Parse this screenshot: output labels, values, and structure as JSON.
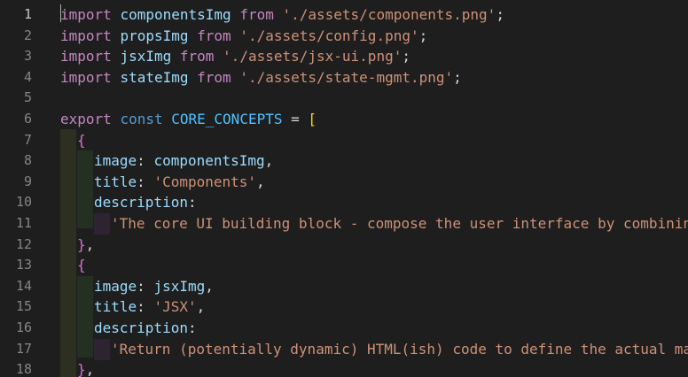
{
  "editor": {
    "line_numbers": [
      "1",
      "2",
      "3",
      "4",
      "5",
      "6",
      "7",
      "8",
      "9",
      "10",
      "11",
      "12",
      "13",
      "14",
      "15",
      "16",
      "17",
      "18"
    ],
    "active_line": "1"
  },
  "code": {
    "l1": {
      "kw": "import",
      "var": "componentsImg",
      "from": "from",
      "str": "'./assets/components.png'",
      "end": ";"
    },
    "l2": {
      "kw": "import",
      "var": "propsImg",
      "from": "from",
      "str": "'./assets/config.png'",
      "end": ";"
    },
    "l3": {
      "kw": "import",
      "var": "jsxImg",
      "from": "from",
      "str": "'./assets/jsx-ui.png'",
      "end": ";"
    },
    "l4": {
      "kw": "import",
      "var": "stateImg",
      "from": "from",
      "str": "'./assets/state-mgmt.png'",
      "end": ";"
    },
    "l6": {
      "export": "export",
      "const": "const",
      "name": "CORE_CONCEPTS",
      "eq": " = ",
      "bracket": "["
    },
    "l7": {
      "brace": "{"
    },
    "l8": {
      "prop": "image",
      "colon": ": ",
      "val": "componentsImg",
      "end": ","
    },
    "l9": {
      "prop": "title",
      "colon": ": ",
      "str": "'Components'",
      "end": ","
    },
    "l10": {
      "prop": "description",
      "colon": ":"
    },
    "l11": {
      "str": "'The core UI building block - compose the user interface by combinin"
    },
    "l12": {
      "brace": "}",
      "end": ","
    },
    "l13": {
      "brace": "{"
    },
    "l14": {
      "prop": "image",
      "colon": ": ",
      "val": "jsxImg",
      "end": ","
    },
    "l15": {
      "prop": "title",
      "colon": ": ",
      "str": "'JSX'",
      "end": ","
    },
    "l16": {
      "prop": "description",
      "colon": ":"
    },
    "l17": {
      "str": "'Return (potentially dynamic) HTML(ish) code to define the actual ma"
    },
    "l18": {
      "brace": "}",
      "end": ","
    }
  }
}
